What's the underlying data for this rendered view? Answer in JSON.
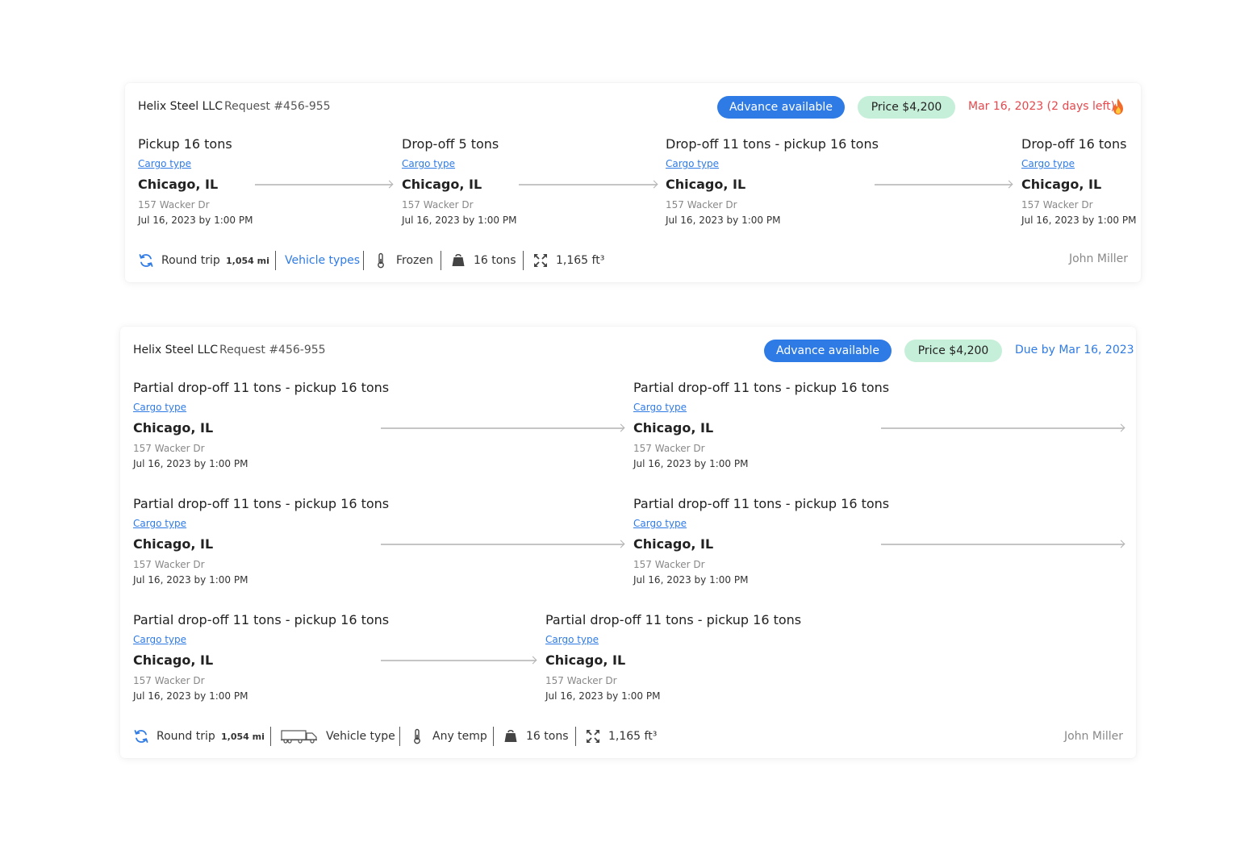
{
  "cards": [
    {
      "company": "Helix Steel LLC",
      "request": "Request #456-955",
      "advance": "Advance available",
      "price": "Price $4,200",
      "deadline": "Mar 16, 2023 (2 days left)",
      "deadline_icon": "fire-icon",
      "stops": [
        {
          "title": "Pickup 16 tons",
          "cargo": "Cargo type",
          "city": "Chicago, IL",
          "address": "157 Wacker Dr",
          "date": "Jul 16, 2023 by 1:00 PM"
        },
        {
          "title": "Drop-off 5 tons",
          "cargo": "Cargo type",
          "city": "Chicago, IL",
          "address": "157 Wacker Dr",
          "date": "Jul 16, 2023 by 1:00 PM"
        },
        {
          "title": "Drop-off 11 tons - pickup 16 tons",
          "cargo": "Cargo type",
          "city": "Chicago, IL",
          "address": "157 Wacker Dr",
          "date": "Jul 16, 2023 by 1:00 PM"
        },
        {
          "title": "Drop-off 16 tons",
          "cargo": "Cargo type",
          "city": "Chicago, IL",
          "address": "157 Wacker Dr",
          "date": "Jul 16, 2023 by 1:00 PM"
        }
      ],
      "footer": {
        "trip": "Round trip",
        "distance": "1,054 mi",
        "vehicle": "Vehicle types",
        "temp": "Frozen",
        "weight": "16 tons",
        "volume": "1,165 ft³",
        "owner": "John Miller"
      }
    },
    {
      "company": "Helix Steel LLC",
      "request": "Request #456-955",
      "advance": "Advance available",
      "price": "Price $4,200",
      "deadline": "Due by Mar 16, 2023",
      "stops": [
        {
          "title": "Partial drop-off 11 tons - pickup 16 tons",
          "cargo": "Cargo type",
          "city": "Chicago, IL",
          "address": "157 Wacker Dr",
          "date": "Jul 16, 2023 by 1:00 PM"
        },
        {
          "title": "Partial drop-off 11 tons - pickup 16 tons",
          "cargo": "Cargo type",
          "city": "Chicago, IL",
          "address": "157 Wacker Dr",
          "date": "Jul 16, 2023 by 1:00 PM"
        },
        {
          "title": "Partial drop-off 11 tons - pickup 16 tons",
          "cargo": "Cargo type",
          "city": "Chicago, IL",
          "address": "157 Wacker Dr",
          "date": "Jul 16, 2023 by 1:00 PM"
        },
        {
          "title": "Partial drop-off 11 tons - pickup 16 tons",
          "cargo": "Cargo type",
          "city": "Chicago, IL",
          "address": "157 Wacker Dr",
          "date": "Jul 16, 2023 by 1:00 PM"
        },
        {
          "title": "Partial drop-off 11 tons - pickup 16 tons",
          "cargo": "Cargo type",
          "city": "Chicago, IL",
          "address": "157 Wacker Dr",
          "date": "Jul 16, 2023 by 1:00 PM"
        },
        {
          "title": "Partial drop-off 11 tons - pickup 16 tons",
          "cargo": "Cargo type",
          "city": "Chicago, IL",
          "address": "157 Wacker Dr",
          "date": "Jul 16, 2023 by 1:00 PM"
        }
      ],
      "footer": {
        "trip": "Round trip",
        "distance": "1,054 mi",
        "vehicle": "Vehicle type",
        "vehicle_icon": "truck-icon",
        "temp": "Any temp",
        "weight": "16 tons",
        "volume": "1,165 ft³",
        "owner": "John Miller"
      }
    }
  ],
  "colors": {
    "accent": "#2f7be6",
    "price_bg": "#c6efd9",
    "urgent": "#e5484d",
    "fire": "#f26b2a"
  }
}
